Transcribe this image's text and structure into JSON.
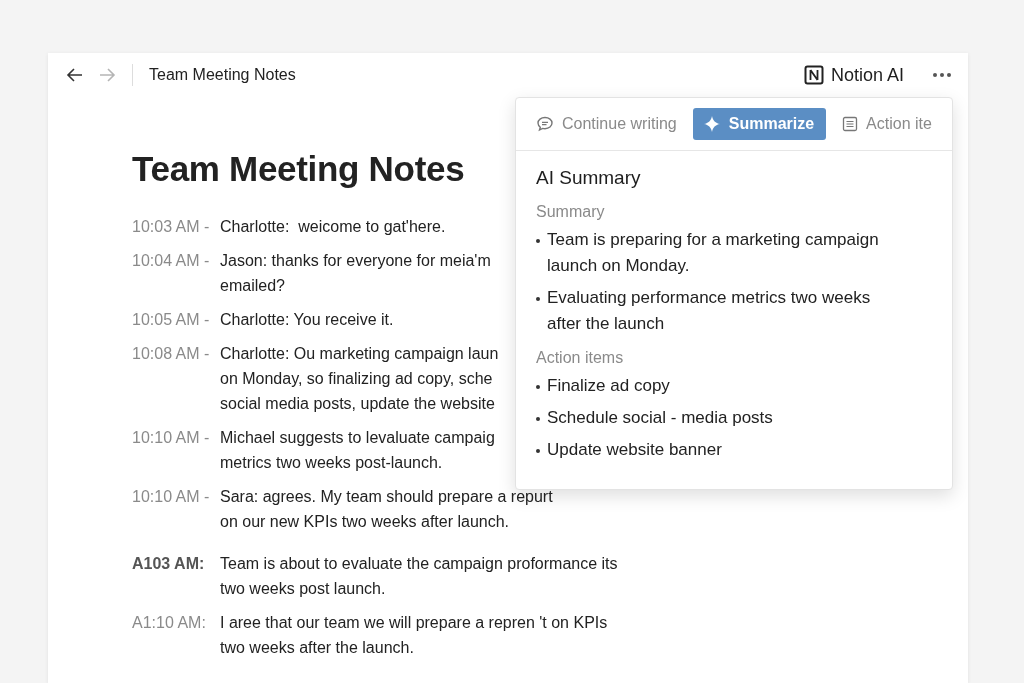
{
  "nav": {
    "back": {
      "disabled": false
    },
    "forward": {
      "disabled": true
    }
  },
  "breadcrumb": "Team Meeting Notes",
  "ai_button": "Notion AI",
  "title": "Team Meeting Notes",
  "notes": [
    {
      "time": "10:03 AM -",
      "bold": false,
      "lines": [
        "Charlotte:  weicome to gat'here."
      ]
    },
    {
      "time": "10:04 AM -",
      "bold": false,
      "lines": [
        "Jason: thanks for everyone for meia'm",
        "emailed?"
      ]
    },
    {
      "time": "10:05 AM -",
      "bold": false,
      "lines": [
        "Charlotte: You receive it."
      ]
    },
    {
      "time": "10:08 AM -",
      "bold": false,
      "lines": [
        "Charlotte: Ou marketing campaign laun",
        "on Monday, so finalizing ad copy, sche",
        "social media posts, update the website"
      ]
    },
    {
      "time": "10:10 AM -",
      "bold": false,
      "lines": [
        "Michael suggests to levaluate campaig",
        "metrics two weeks post-launch."
      ]
    },
    {
      "time": "10:10 AM -",
      "bold": false,
      "lines": [
        "Sara: agrees. My team should prepare a repurt",
        "on our new KPIs two weeks after launch."
      ]
    },
    {
      "time": "A103 AM:",
      "bold": true,
      "lines": [
        "Team is about to evaluate the campaign proformance its",
        "two weeks post launch."
      ]
    },
    {
      "time": "A1:10 AM:",
      "bold": false,
      "lines": [
        "I aree that our team we will prepare a repren 't on KPIs",
        "two weeks after the launch."
      ]
    }
  ],
  "ai_panel": {
    "tabs": [
      {
        "label": "Continue writing",
        "kind": "chat",
        "selected": false
      },
      {
        "label": "Summarize",
        "kind": "sparkle",
        "selected": true
      },
      {
        "label": "Action ite",
        "kind": "list",
        "selected": false
      }
    ],
    "heading": "AI Summary",
    "sections": [
      {
        "label": "Summary",
        "items": [
          "Team is preparing for a marketing campaign launch on Monday.",
          "Evaluating performance metrics two weeks after the launch"
        ]
      },
      {
        "label": "Action items",
        "items": [
          "Finalize ad copy",
          "Schedule social - media posts",
          "Update website banner"
        ]
      }
    ]
  }
}
